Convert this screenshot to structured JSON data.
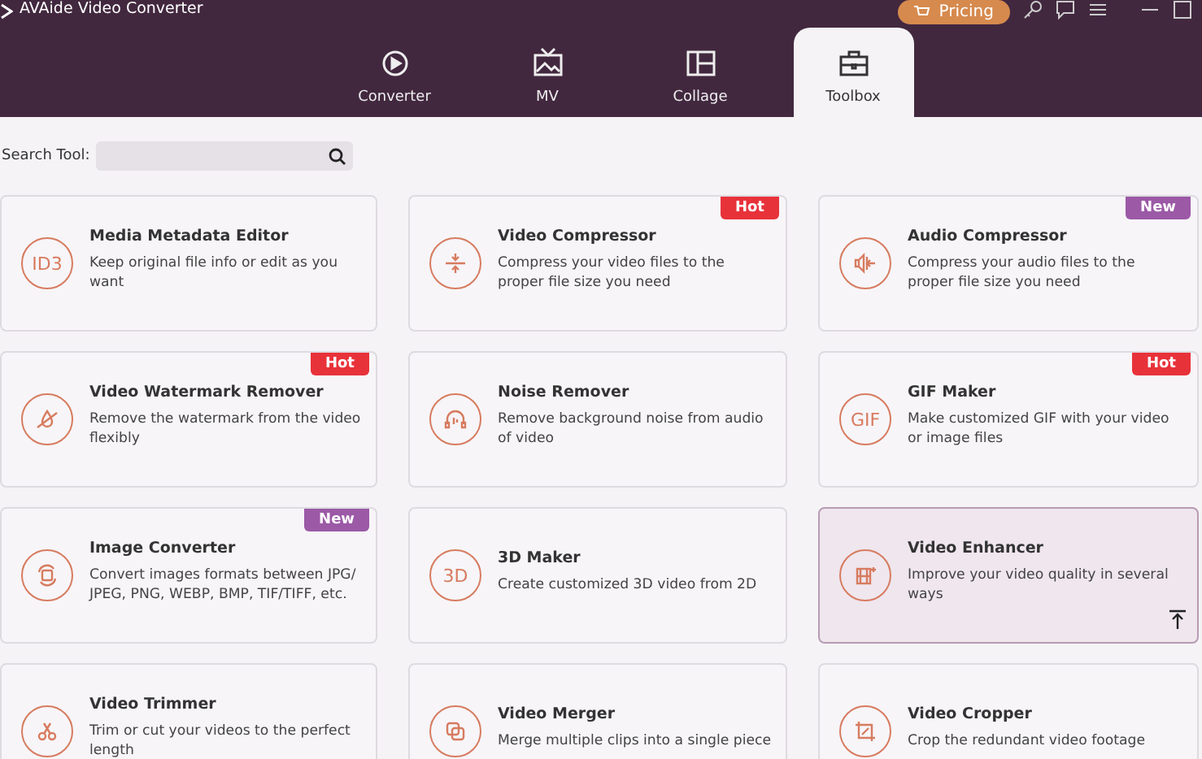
{
  "window": {
    "title": "AVAide Video Converter",
    "pricing_button": "Pricing"
  },
  "tabs": [
    {
      "label": "Converter",
      "selected": false
    },
    {
      "label": "MV",
      "selected": false
    },
    {
      "label": "Collage",
      "selected": false
    },
    {
      "label": "Toolbox",
      "selected": true
    }
  ],
  "search": {
    "label": "Search Tool:"
  },
  "tools": [
    {
      "name": "Media Metadata Editor",
      "description": "Keep original file info or edit as you want",
      "kind": "text",
      "icon_text": "ID3",
      "selected": false
    },
    {
      "name": "Video Compressor",
      "description": "Compress your video files to the proper file size you need",
      "kind": "compress",
      "badge": {
        "text": "Hot",
        "color": "#e8323a"
      },
      "selected": false
    },
    {
      "name": "Audio Compressor",
      "description": "Compress your audio files to the proper file size you need",
      "kind": "audio",
      "badge": {
        "text": "New",
        "color": "#9b59a6"
      },
      "selected": false
    },
    {
      "name": "Video Watermark Remover",
      "description": "Remove the watermark from the video flexibly",
      "kind": "drop",
      "badge": {
        "text": "Hot",
        "color": "#e8323a"
      },
      "selected": false
    },
    {
      "name": "Noise Remover",
      "description": "Remove background noise from audio of video",
      "kind": "headphones",
      "selected": false
    },
    {
      "name": "GIF Maker",
      "description": "Make customized GIF with your video or image files",
      "kind": "text",
      "icon_text": "GIF",
      "badge": {
        "text": "Hot",
        "color": "#e8323a"
      },
      "selected": false
    },
    {
      "name": "Image Converter",
      "description": "Convert images formats between JPG/ JPEG, PNG, WEBP, BMP, TIF/TIFF, etc.",
      "kind": "image",
      "badge": {
        "text": "New",
        "color": "#9b59a6"
      },
      "selected": false
    },
    {
      "name": "3D Maker",
      "description": "Create customized 3D video from 2D",
      "kind": "text",
      "icon_text": "3D",
      "selected": false
    },
    {
      "name": "Video Enhancer",
      "description": "Improve your video quality in several ways",
      "kind": "enhance",
      "selected": true
    },
    {
      "name": "Video Trimmer",
      "description": "Trim or cut your videos to the perfect length",
      "kind": "scissors",
      "selected": false
    },
    {
      "name": "Video Merger",
      "description": "Merge multiple clips into a single piece",
      "kind": "merge",
      "selected": false
    },
    {
      "name": "Video Cropper",
      "description": "Crop the redundant video footage",
      "kind": "crop",
      "selected": false
    }
  ]
}
